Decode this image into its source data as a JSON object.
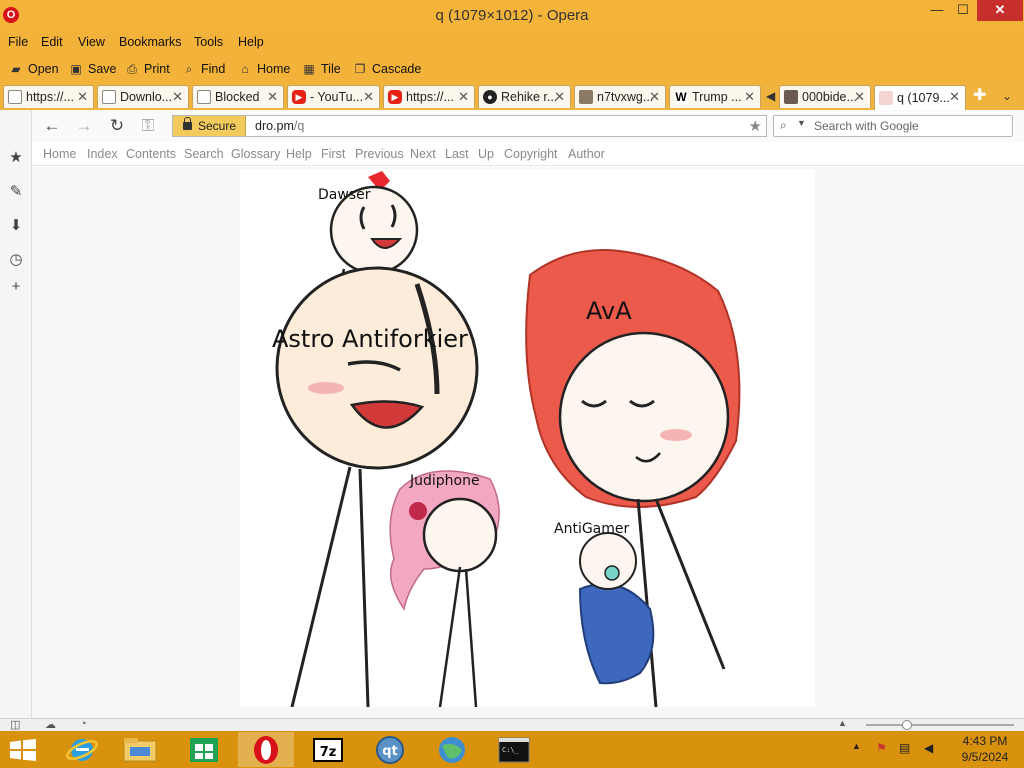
{
  "window": {
    "title": "q (1079×1012) - Opera",
    "min": "—",
    "max": "☐",
    "close": "✕"
  },
  "menu": [
    "File",
    "Edit",
    "View",
    "Bookmarks",
    "Tools",
    "Help"
  ],
  "toolbar": [
    "Open",
    "Save",
    "Print",
    "Find",
    "Home",
    "Tile",
    "Cascade"
  ],
  "tabs": [
    {
      "label": "https://...",
      "fav": "page-icon"
    },
    {
      "label": "Downlo...",
      "fav": "page-icon"
    },
    {
      "label": "Blocked",
      "fav": "page-icon"
    },
    {
      "label": "- YouTu...",
      "fav": "youtube-icon"
    },
    {
      "label": "https://...",
      "fav": "youtube-icon"
    },
    {
      "label": "Rehike r...",
      "fav": "github-icon"
    },
    {
      "label": "n7tvxwg...",
      "fav": "image-icon"
    },
    {
      "label": "Trump ...",
      "fav": "wikipedia-icon"
    },
    {
      "label": "000bide...",
      "fav": "image-icon"
    },
    {
      "label": "q (1079...",
      "fav": "image-icon"
    }
  ],
  "addressbar": {
    "secure": "Secure",
    "host": "dro.pm",
    "path": "/q",
    "search_placeholder": "Search with Google"
  },
  "navlinks": [
    "Home",
    "Index",
    "Contents",
    "Search",
    "Glossary",
    "Help",
    "First",
    "Previous",
    "Next",
    "Last",
    "Up",
    "Copyright",
    "Author"
  ],
  "drawing": {
    "labels": [
      "Dawser",
      "Astro Antiforkier",
      "AvA",
      "Judiphone",
      "AntiGamer"
    ]
  },
  "clock": {
    "time": "4:43 PM",
    "date": "9/5/2024"
  },
  "colors": {
    "titlebar": "#f4b43a",
    "taskbar": "#d9920d",
    "close": "#c7302a",
    "secure": "#f2cb5c"
  }
}
